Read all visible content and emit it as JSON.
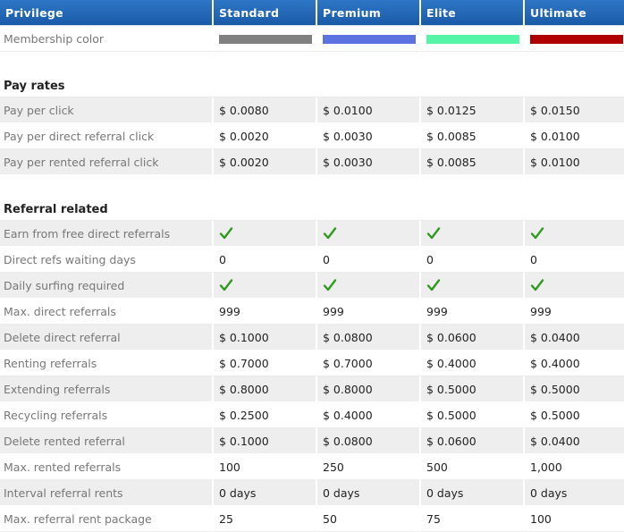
{
  "header": [
    "Privilege",
    "Standard",
    "Premium",
    "Elite",
    "Ultimate"
  ],
  "membership_color": {
    "label": "Membership color",
    "colors": [
      "#808080",
      "#5b72e0",
      "#55f5a8",
      "#b00000"
    ]
  },
  "pay_rates": {
    "title": "Pay rates",
    "rows": [
      {
        "label": "Pay per click",
        "values": [
          "$ 0.0080",
          "$ 0.0100",
          "$ 0.0125",
          "$ 0.0150"
        ]
      },
      {
        "label": "Pay per direct referral click",
        "values": [
          "$ 0.0020",
          "$ 0.0030",
          "$ 0.0085",
          "$ 0.0100"
        ]
      },
      {
        "label": "Pay per rented referral click",
        "values": [
          "$ 0.0020",
          "$ 0.0030",
          "$ 0.0085",
          "$ 0.0100"
        ]
      }
    ]
  },
  "referral": {
    "title": "Referral related",
    "rows": [
      {
        "label": "Earn from free direct referrals",
        "values": [
          "check-icon",
          "check-icon",
          "check-icon",
          "check-icon"
        ]
      },
      {
        "label": "Direct refs waiting days",
        "values": [
          "0",
          "0",
          "0",
          "0"
        ]
      },
      {
        "label": "Daily surfing required",
        "values": [
          "check-icon",
          "check-icon",
          "check-icon",
          "check-icon"
        ]
      },
      {
        "label": "Max. direct referrals",
        "values": [
          "999",
          "999",
          "999",
          "999"
        ]
      },
      {
        "label": "Delete direct referral",
        "values": [
          "$ 0.1000",
          "$ 0.0800",
          "$ 0.0600",
          "$ 0.0400"
        ]
      },
      {
        "label": "Renting referrals",
        "values": [
          "$ 0.7000",
          "$ 0.7000",
          "$ 0.4000",
          "$ 0.4000"
        ]
      },
      {
        "label": "Extending referrals",
        "values": [
          "$ 0.8000",
          "$ 0.8000",
          "$ 0.5000",
          "$ 0.5000"
        ]
      },
      {
        "label": "Recycling referrals",
        "values": [
          "$ 0.2500",
          "$ 0.4000",
          "$ 0.5000",
          "$ 0.5000"
        ]
      },
      {
        "label": "Delete rented referral",
        "values": [
          "$ 0.1000",
          "$ 0.0800",
          "$ 0.0600",
          "$ 0.0400"
        ]
      },
      {
        "label": "Max. rented referrals",
        "values": [
          "100",
          "250",
          "500",
          "1,000"
        ]
      },
      {
        "label": "Interval referral rents",
        "values": [
          "0 days",
          "0 days",
          "0 days",
          "0 days"
        ]
      },
      {
        "label": "Max. referral rent package",
        "values": [
          "25",
          "50",
          "75",
          "100"
        ]
      }
    ]
  },
  "check_color": "#2e9a1e"
}
